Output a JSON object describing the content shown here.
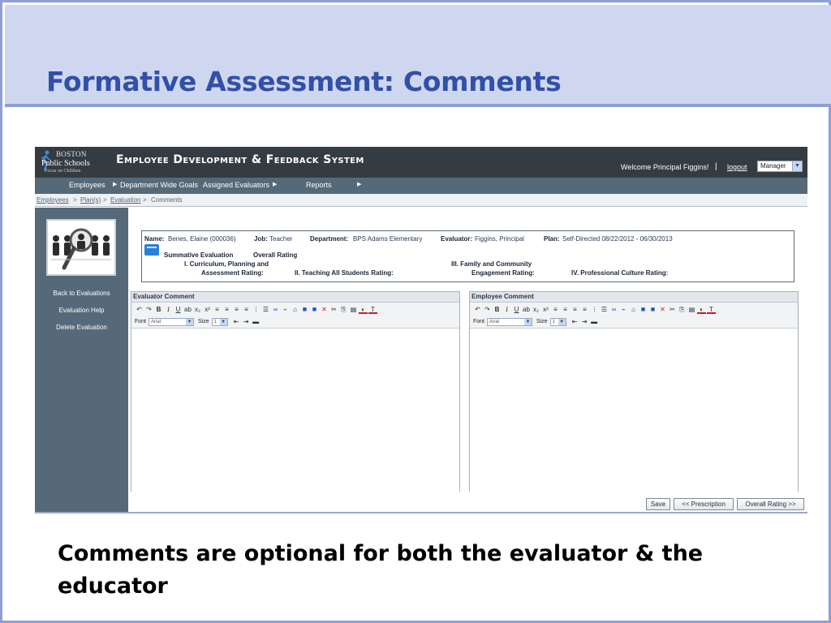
{
  "slide": {
    "title": "Formative Assessment: Comments",
    "caption": "Comments are optional for both the evaluator & the educator"
  },
  "app": {
    "logo": {
      "line1": "BOSTON",
      "line2": "Public Schools",
      "line3": "Focus on Children"
    },
    "title": "Employee Development & Feedback System",
    "welcome": "Welcome Principal Figgins!",
    "separator": "|",
    "logout": "logout",
    "role": "Manager",
    "menu": {
      "employees": "Employees",
      "department_goals": "Department Wide Goals",
      "assigned_evaluators": "Assigned Evaluators",
      "reports": "Reports"
    },
    "breadcrumb": {
      "employees": "Employees",
      "plans": "Plan(s)",
      "evaluation": "Evaluation",
      "current": "Comments",
      "sep": ">"
    },
    "left_nav": {
      "back": "Back to Evaluations",
      "help": "Evaluation Help",
      "delete": "Delete Evaluation"
    },
    "info": {
      "name_label": "Name:",
      "name_value": "Benes, Elaine (000036)",
      "job_label": "Job:",
      "job_value": "Teacher",
      "dept_label": "Department:",
      "dept_value": "BPS Adams Elementary",
      "evaluator_label": "Evaluator:",
      "evaluator_value": "Figgins, Principal",
      "plan_label": "Plan:",
      "plan_value": "Self-Directed 08/22/2012 - 06/30/2013",
      "summative": "Summative Evaluation",
      "overall": "Overall Rating",
      "rating1_a": "I. Curriculum, Planning and",
      "rating1_b": "Assessment Rating:",
      "rating2": "II. Teaching All Students Rating:",
      "rating3_a": "III. Family and Community",
      "rating3_b": "Engagement Rating:",
      "rating4": "IV. Professional Culture Rating:"
    },
    "editors": {
      "evaluator_title": "Evaluator Comment",
      "employee_title": "Employee Comment",
      "font_label": "Font",
      "font_value": "Arial",
      "size_label": "Size",
      "size_value": "1"
    },
    "buttons": {
      "save": "Save",
      "prescription": "<< Prescription",
      "overall_rating": "Overall Rating >>"
    }
  },
  "colors": {
    "title_band": "#cfd6ef",
    "title_text": "#3150a8",
    "app_header": "#343b41",
    "menubar": "#566978"
  }
}
